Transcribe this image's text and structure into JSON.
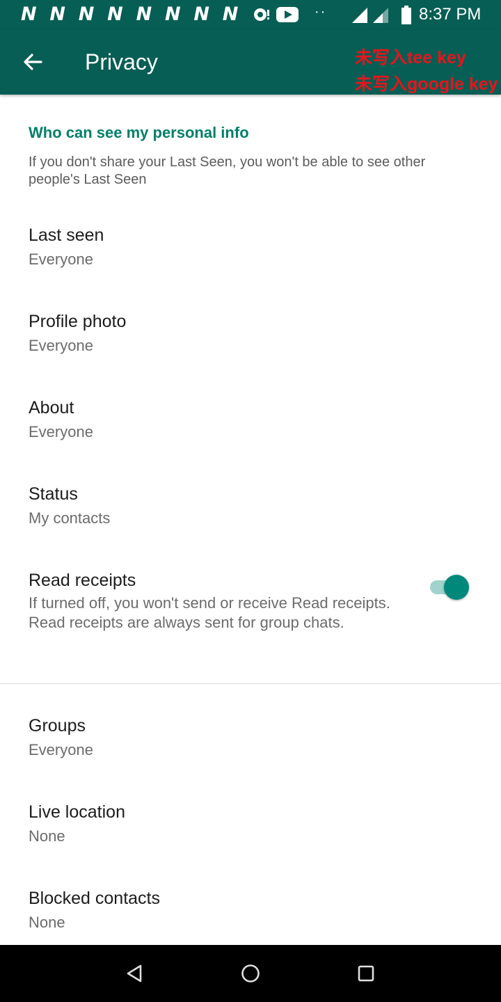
{
  "status_bar": {
    "notification_letters": [
      "N",
      "N",
      "N",
      "N",
      "N",
      "N",
      "N",
      "N"
    ],
    "time": "8:37 PM",
    "dots": "··",
    "icons": [
      "notification-n-icon",
      "chat-badge-icon",
      "youtube-icon",
      "signal-icon",
      "signal-icon-2",
      "battery-icon"
    ]
  },
  "app_bar": {
    "title": "Privacy",
    "back_icon": "arrow-left-icon",
    "debug_line_1": "未写入tee key",
    "debug_line_2": "未写入google key",
    "color": "#075e54"
  },
  "section": {
    "header": "Who can see my personal info",
    "description": "If you don't share your Last Seen, you won't be able to see other people's Last Seen"
  },
  "settings": [
    {
      "title": "Last seen",
      "value": "Everyone"
    },
    {
      "title": "Profile photo",
      "value": "Everyone"
    },
    {
      "title": "About",
      "value": "Everyone"
    },
    {
      "title": "Status",
      "value": "My contacts"
    }
  ],
  "read_receipts": {
    "title": "Read receipts",
    "description": "If turned off, you won't send or receive Read receipts. Read receipts are always sent for group chats.",
    "enabled": true
  },
  "more_settings": [
    {
      "title": "Groups",
      "value": "Everyone"
    },
    {
      "title": "Live location",
      "value": "None"
    },
    {
      "title": "Blocked contacts",
      "value": "None"
    }
  ],
  "nav_bar": {
    "icons": [
      "back-triangle-icon",
      "home-circle-icon",
      "recents-square-icon"
    ]
  },
  "colors": {
    "accent": "#008069",
    "toggle": "#00897b",
    "debug_text": "#e8141c"
  }
}
